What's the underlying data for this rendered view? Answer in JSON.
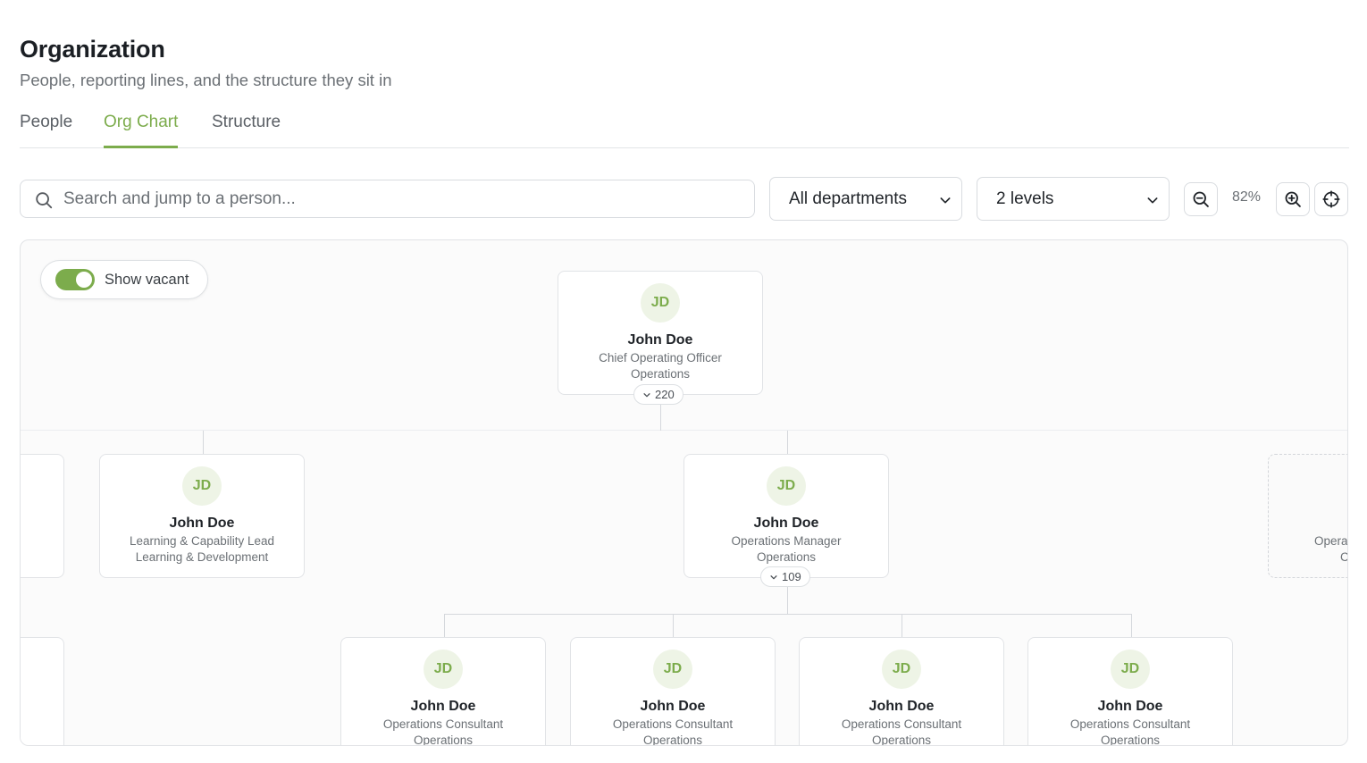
{
  "header": {
    "title": "Organization",
    "subtitle": "People, reporting lines, and the structure they sit in"
  },
  "tabs": [
    {
      "label": "People",
      "active": false
    },
    {
      "label": "Org Chart",
      "active": true
    },
    {
      "label": "Structure",
      "active": false
    }
  ],
  "toolbar": {
    "search_placeholder": "Search and jump to a person...",
    "department_filter": "All departments",
    "levels_filter": "2 levels",
    "zoom_level": "82%"
  },
  "canvas": {
    "show_vacant_label": "Show vacant",
    "show_vacant_on": true
  },
  "org": {
    "root": {
      "initials": "JD",
      "name": "John Doe",
      "title": "Chief Operating Officer",
      "department": "Operations",
      "reports": "220"
    },
    "level1": [
      {
        "initials": "JD",
        "name": "John Doe",
        "title": "Learning & Capability Lead",
        "department": "Learning & Development"
      },
      {
        "initials": "JD",
        "name": "John Doe",
        "title": "Operations Manager",
        "department": "Operations",
        "reports": "109"
      }
    ],
    "level1_edge_right_partial": {
      "title": "Opera",
      "department": "C"
    },
    "level2": [
      {
        "initials": "JD",
        "name": "John Doe",
        "title": "Operations Consultant",
        "department": "Operations"
      },
      {
        "initials": "JD",
        "name": "John Doe",
        "title": "Operations Consultant",
        "department": "Operations"
      },
      {
        "initials": "JD",
        "name": "John Doe",
        "title": "Operations Consultant",
        "department": "Operations"
      },
      {
        "initials": "JD",
        "name": "John Doe",
        "title": "Operations Consultant",
        "department": "Operations"
      }
    ]
  },
  "colors": {
    "accent": "#7cac4c",
    "avatar_bg": "#eef4e6",
    "border": "#e1e3e6",
    "connector": "#d5d8dc"
  },
  "icons": {
    "search": "search-icon",
    "select_chevron": "chevron-down-icon",
    "zoom_out": "zoom-out-icon",
    "zoom_in": "zoom-in-icon",
    "recenter": "crosshair-icon",
    "collapse": "chevron-down-icon"
  }
}
